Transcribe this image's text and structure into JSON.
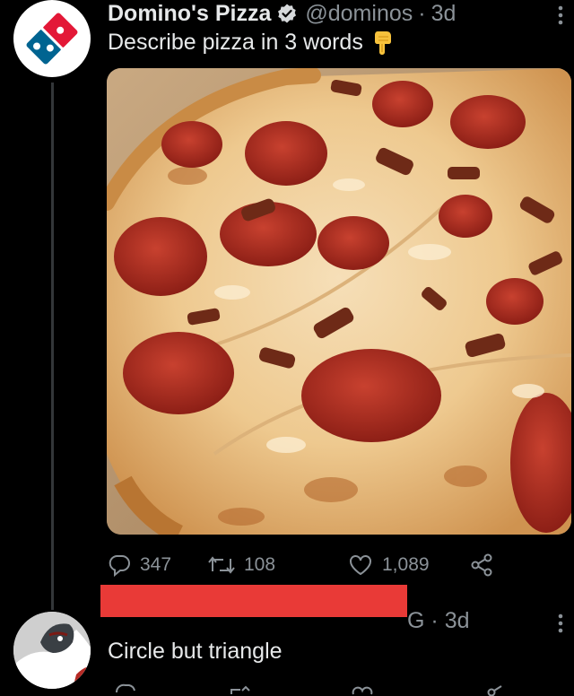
{
  "tweet": {
    "author_name": "Domino's Pizza",
    "author_handle": "@dominos",
    "separator": "·",
    "time": "3d",
    "text": "Describe pizza in 3 words",
    "emoji": "backhand-index-pointing-down",
    "media_subject": "pepperoni-bacon-pizza-photo",
    "stats": {
      "replies": "347",
      "retweets": "108",
      "likes": "1,089"
    }
  },
  "reply": {
    "author_suffix": "G",
    "separator": "·",
    "time": "3d",
    "text": "Circle but triangle",
    "name_redacted": true
  },
  "colors": {
    "background": "#000000",
    "text": "#e7e9ea",
    "muted": "#8b9298",
    "dominos_blue": "#006491",
    "dominos_red": "#e31837",
    "redaction_red": "#e93a37"
  }
}
